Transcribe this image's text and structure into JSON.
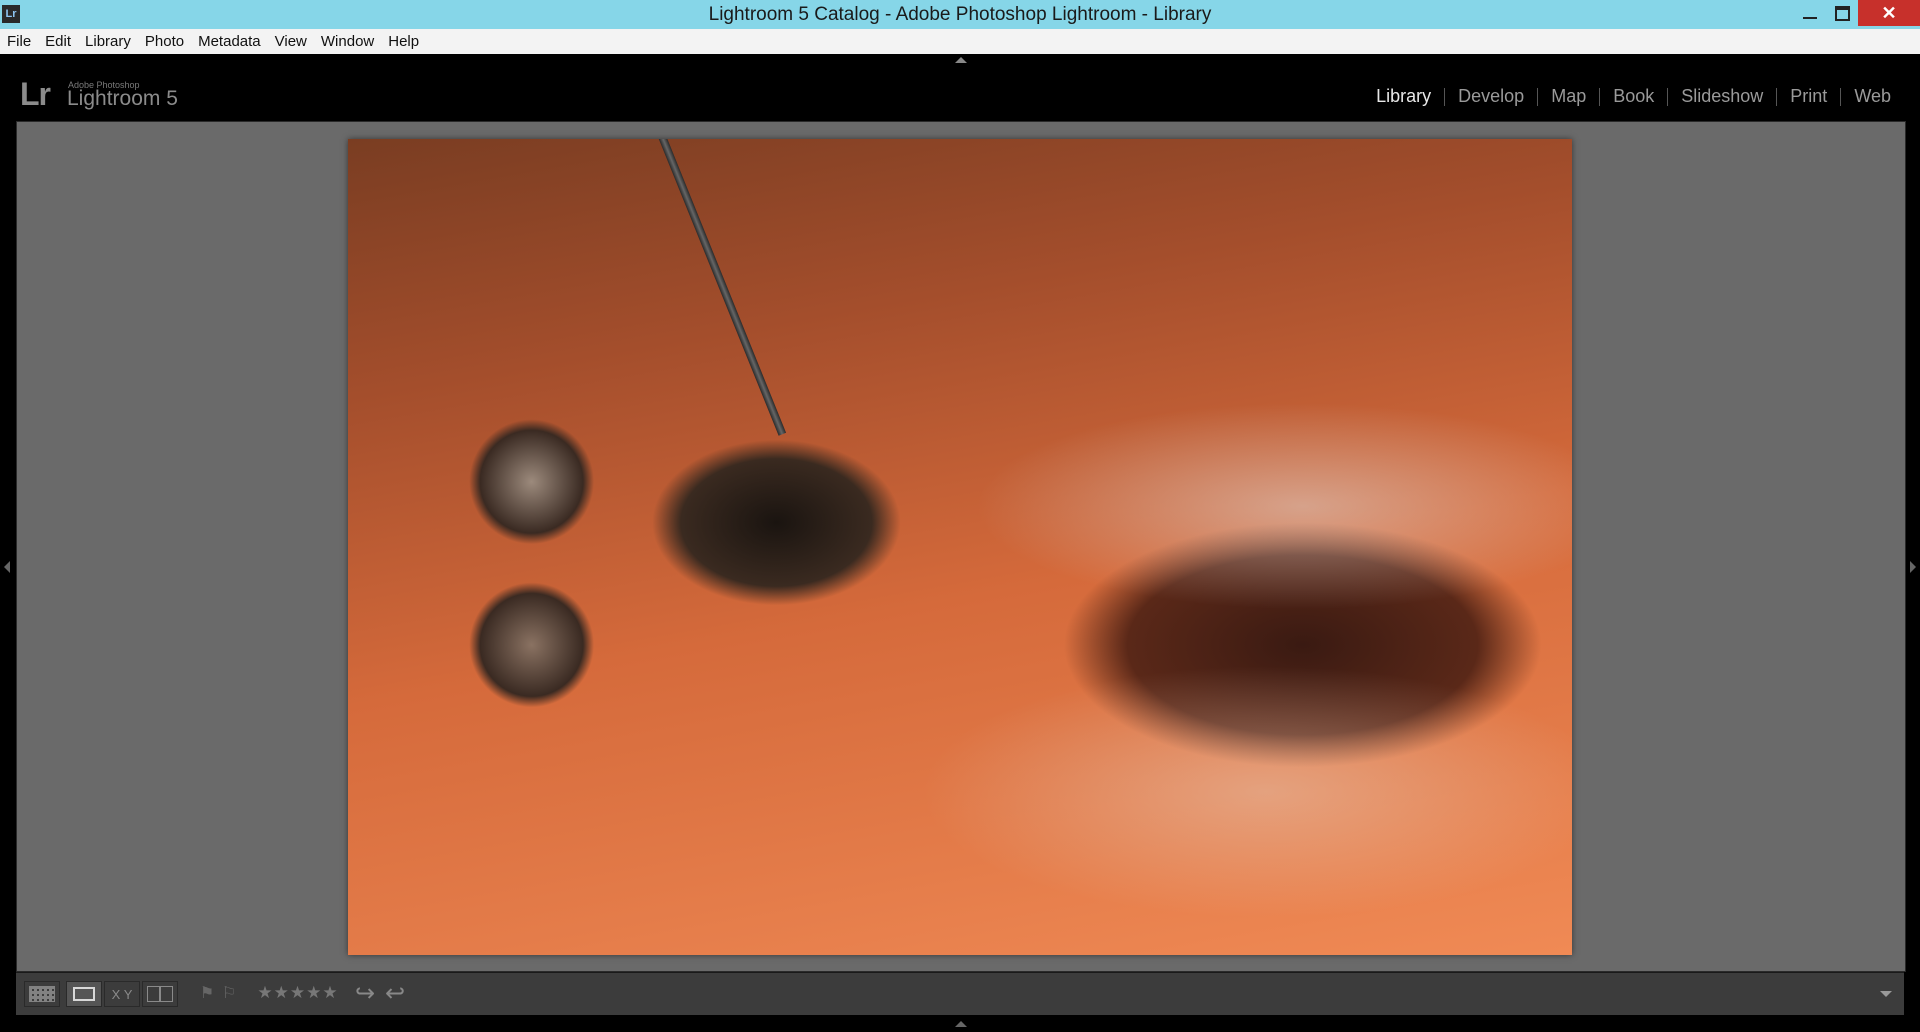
{
  "window": {
    "title": "Lightroom 5 Catalog - Adobe Photoshop Lightroom - Library",
    "app_icon_label": "Lr",
    "close_glyph": "✕"
  },
  "menu": {
    "items": [
      "File",
      "Edit",
      "Library",
      "Photo",
      "Metadata",
      "View",
      "Window",
      "Help"
    ]
  },
  "identity": {
    "logo_mark": "Lr",
    "small_text": "Adobe Photoshop",
    "product_name": "Lightroom 5"
  },
  "modules": {
    "items": [
      "Library",
      "Develop",
      "Map",
      "Book",
      "Slideshow",
      "Print",
      "Web"
    ],
    "active": "Library"
  },
  "toolbar": {
    "compare_glyph": "X Y",
    "pick_flag_glyph": "⚑",
    "reject_flag_glyph": "⚐",
    "stars": "★★★★★",
    "rotate_ccw_glyph": "↪",
    "rotate_cw_glyph": "↩"
  },
  "colors": {
    "titlebar": "#86d6e8",
    "close_button": "#c7302b",
    "main_background": "#6a6a6a",
    "toolbar_background": "#3c3c3c"
  }
}
